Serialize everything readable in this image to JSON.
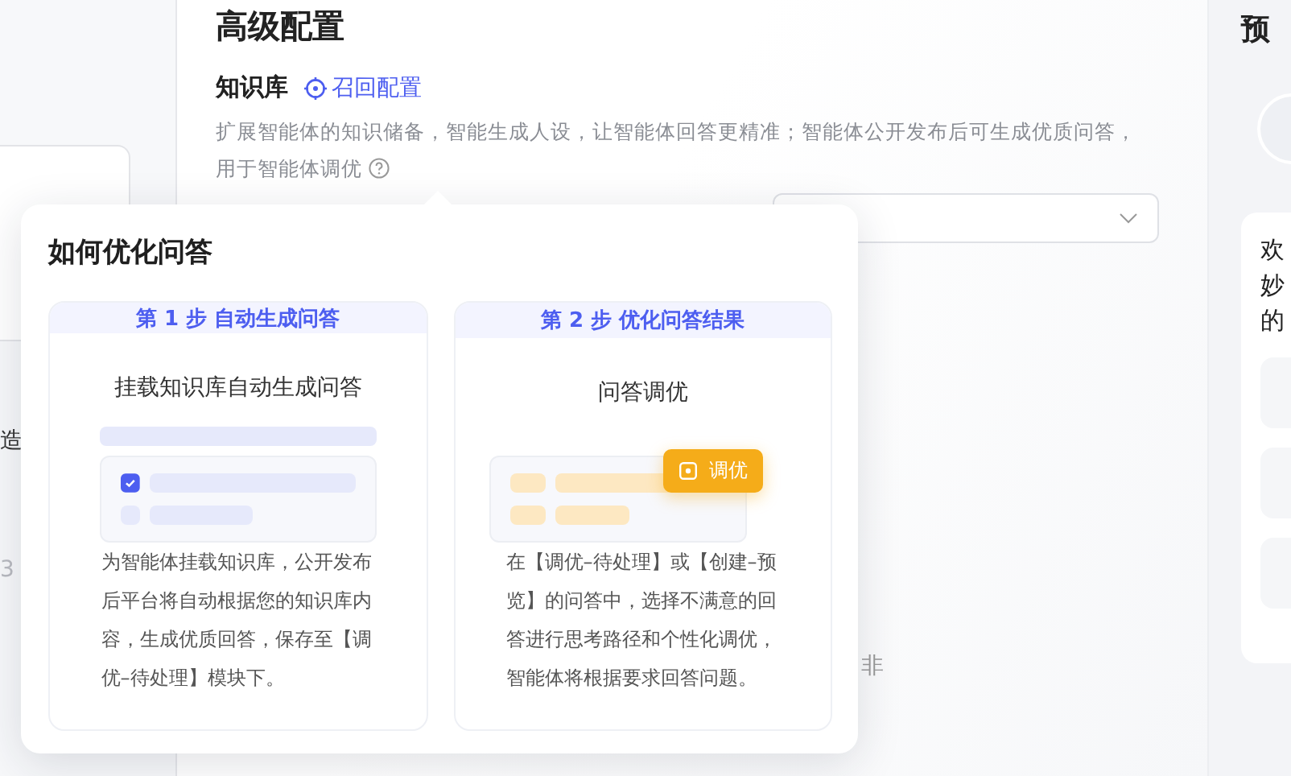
{
  "sidebar": {
    "fragments": [
      {
        "text": "造",
        "muted": false
      },
      {
        "text": "3",
        "muted": true
      }
    ]
  },
  "main": {
    "title": "高级配置",
    "section": {
      "title": "知识库",
      "link": "召回配置",
      "description": "扩展智能体的知识储备，智能生成人设，让智能体回答更精准；智能体公开发布后可生成优质问答，用于智能体调优"
    },
    "trailing_fragment": "非"
  },
  "popover": {
    "title": "如何优化问答",
    "steps": [
      {
        "kind": "checklist",
        "header": "第 1 步 自动生成问答",
        "title": "挂载知识库自动生成问答",
        "description": "为智能体挂载知识库，公开发布后平台将自动根据您的知识库内容，生成优质回答，保存至【调优–待处理】模块下。"
      },
      {
        "kind": "tuning",
        "header": "第 2 步 优化问答结果",
        "title": "问答调优",
        "badge": "调优",
        "description": "在【调优–待处理】或【创建–预览】的问答中，选择不满意的回答进行思考路径和个性化调优，智能体将根据要求回答问题。"
      }
    ]
  },
  "preview": {
    "title": "预",
    "welcome_lines": [
      "欢",
      "妙",
      "的"
    ]
  }
}
